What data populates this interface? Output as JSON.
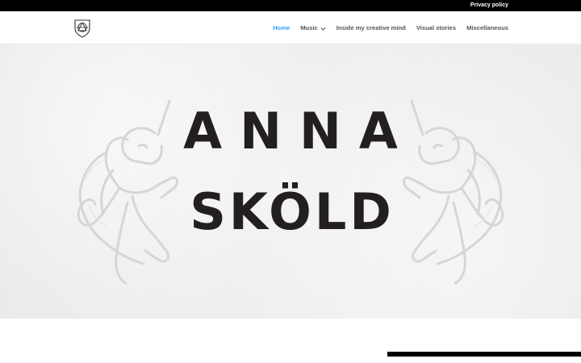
{
  "top_bar": {
    "privacy_label": "Privacy policy"
  },
  "header": {
    "logo_icon": "crest-logo-icon",
    "nav": {
      "home": "Home",
      "music": "Music",
      "inside": "Inside my creative mind",
      "visual": "Visual stories",
      "misc": "Miscellaneous"
    },
    "active_item": "Home"
  },
  "hero": {
    "line1": "ANNA",
    "line2": "SKÖLD",
    "decoration_icons": [
      "unicorn-left-icon",
      "unicorn-right-icon"
    ]
  },
  "colors": {
    "accent": "#2ea3f2",
    "nav_text": "#555555",
    "top_bar": "#000000",
    "title_text": "#231f1f",
    "hero_bg": "#efefef"
  }
}
